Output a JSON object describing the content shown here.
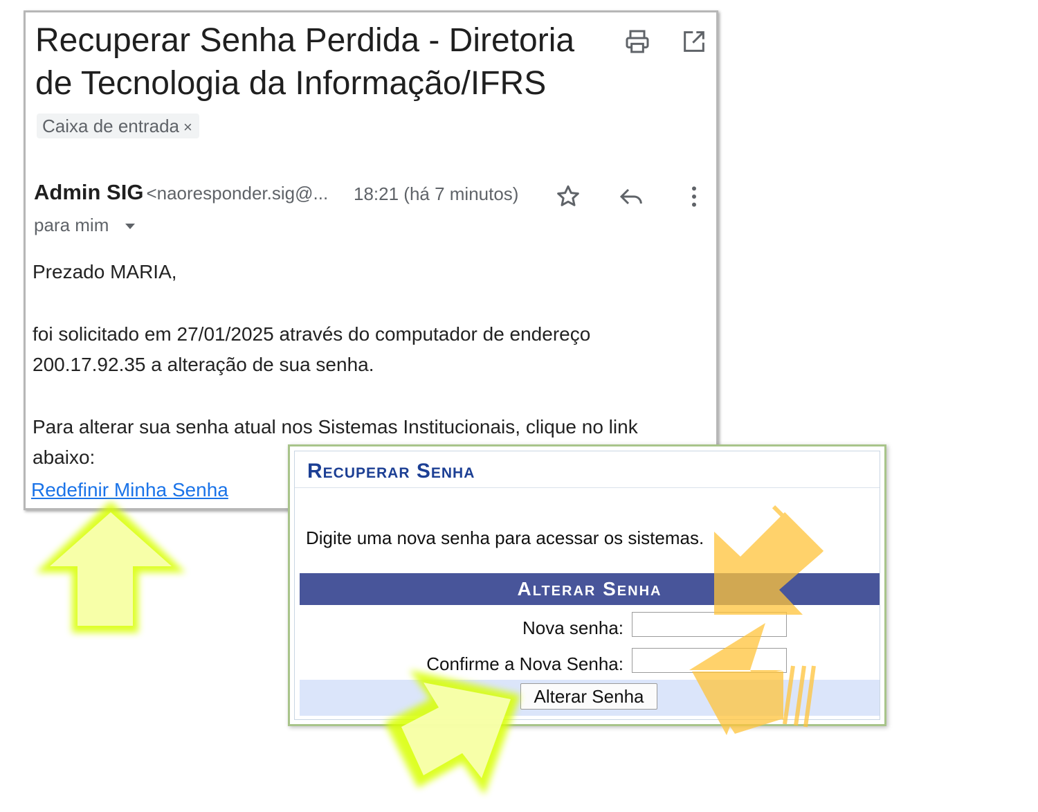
{
  "email": {
    "subject": "Recuperar Senha Perdida - Diretoria de Tecnologia da Informação/IFRS",
    "label": "Caixa de entrada",
    "label_remove": "×",
    "sender_name": "Admin SIG",
    "sender_email": "<naoresponder.sig@...",
    "time": "18:21 (há 7 minutos)",
    "to": "para mim",
    "greeting": "Prezado MARIA,",
    "paragraph1_line1": "foi solicitado em 27/01/2025 através do computador de endereço",
    "paragraph1_line2": "200.17.92.35 a alteração de sua senha.",
    "paragraph2_line1": "Para alterar sua senha atual nos Sistemas Institucionais, clique no link",
    "paragraph2_line2": "abaixo:",
    "link": "Redefinir Minha Senha",
    "icons": [
      "print-icon",
      "open-in-new-window-icon",
      "star-icon",
      "reply-icon",
      "more-vert-icon",
      "caret-down-icon"
    ]
  },
  "sig": {
    "title": "Recuperar Senha",
    "description": "Digite uma nova senha para acessar os sistemas.",
    "form_title": "Alterar Senha",
    "new_password_label": "Nova senha:",
    "confirm_password_label": "Confirme a Nova Senha:",
    "submit": "Alterar Senha"
  },
  "colors": {
    "link": "#1a73e8",
    "sig_title": "#1c3f94",
    "form_header": "#48559a",
    "form_footer": "#dbe5fa",
    "arrow_green": "#e6ff1a",
    "arrow_orange": "#ffc43a"
  }
}
